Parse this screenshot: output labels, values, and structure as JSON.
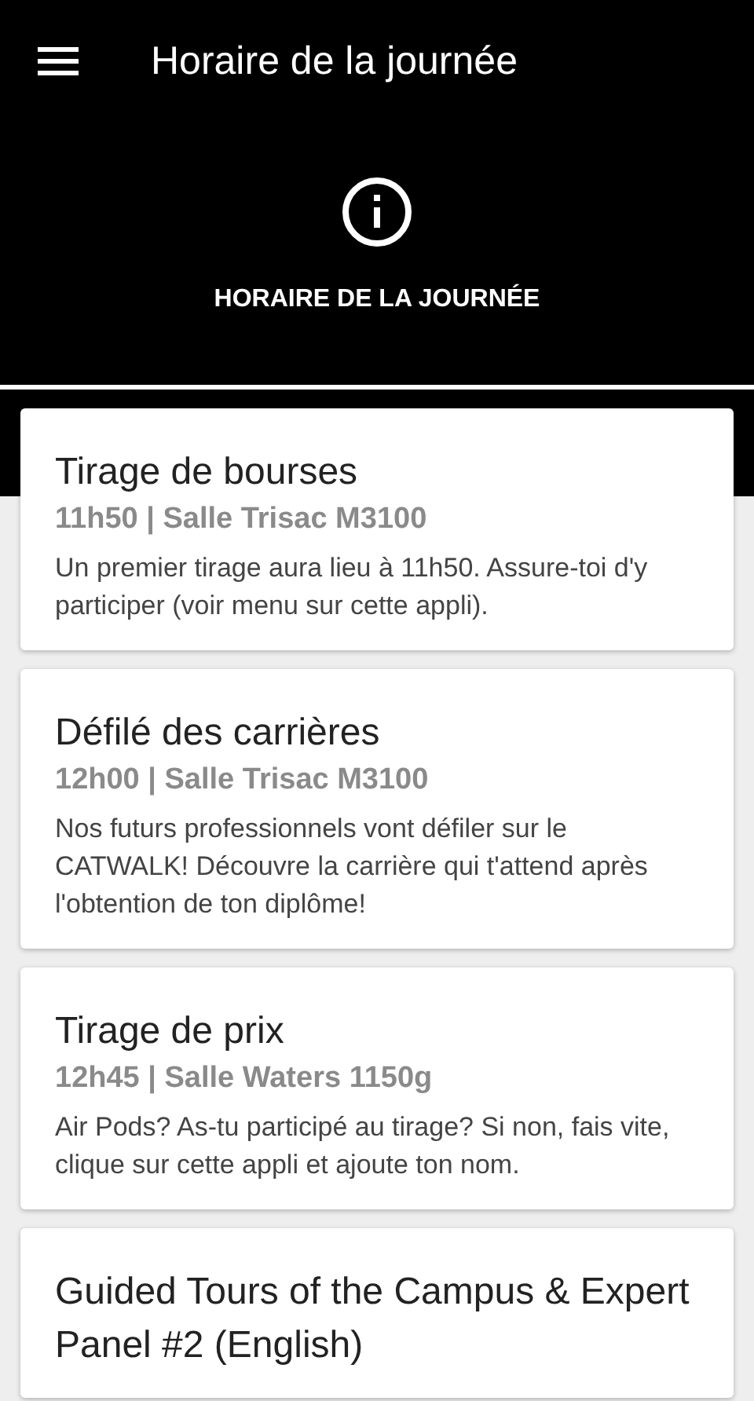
{
  "app_bar": {
    "title": "Horaire de la journée"
  },
  "header": {
    "label": "HORAIRE DE LA JOURNÉE"
  },
  "events": [
    {
      "title": "Tirage de bourses",
      "subtitle": "11h50 | Salle Trisac M3100",
      "description": "Un premier tirage aura lieu à 11h50. Assure-toi d'y participer (voir menu sur cette appli)."
    },
    {
      "title": "Défilé des carrières",
      "subtitle": "12h00 | Salle Trisac M3100",
      "description": "Nos futurs professionnels vont défiler sur le CATWALK! Découvre la carrière qui t'attend après l'obtention de ton diplôme!"
    },
    {
      "title": "Tirage de prix",
      "subtitle": "12h45 | Salle Waters 1150g",
      "description": "Air Pods? As-tu participé au tirage? Si non, fais vite, clique sur cette appli et ajoute ton nom."
    },
    {
      "title": "Guided Tours of the Campus & Expert Panel #2 (English)"
    }
  ]
}
